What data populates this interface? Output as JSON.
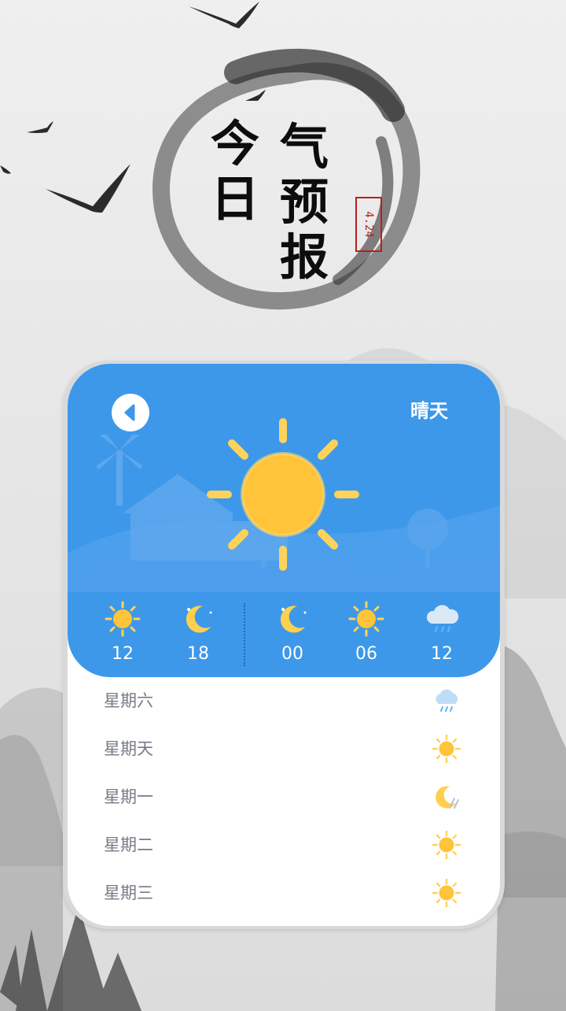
{
  "header": {
    "title_col1": [
      "今",
      "日"
    ],
    "title_col2": [
      "气",
      "预",
      "报"
    ],
    "seal_text": "4.24"
  },
  "card": {
    "condition": "晴天",
    "back_icon": "chevron-left-icon",
    "main_icon": "sun-icon",
    "hourly": [
      {
        "label": "12",
        "icon": "sun-icon"
      },
      {
        "label": "18",
        "icon": "moon-icon"
      },
      {
        "label": "00",
        "icon": "moon-icon"
      },
      {
        "label": "06",
        "icon": "sun-icon"
      },
      {
        "label": "12",
        "icon": "rain-cloud-icon"
      }
    ],
    "daily": [
      {
        "label": "星期六",
        "icon": "rain-cloud-icon"
      },
      {
        "label": "星期天",
        "icon": "sun-icon"
      },
      {
        "label": "星期一",
        "icon": "moon-rain-icon"
      },
      {
        "label": "星期二",
        "icon": "sun-icon"
      },
      {
        "label": "星期三",
        "icon": "sun-icon"
      }
    ]
  },
  "colors": {
    "card_blue": "#3d98ea",
    "sun_yellow": "#ffc43a",
    "text_gray": "#777b86"
  }
}
